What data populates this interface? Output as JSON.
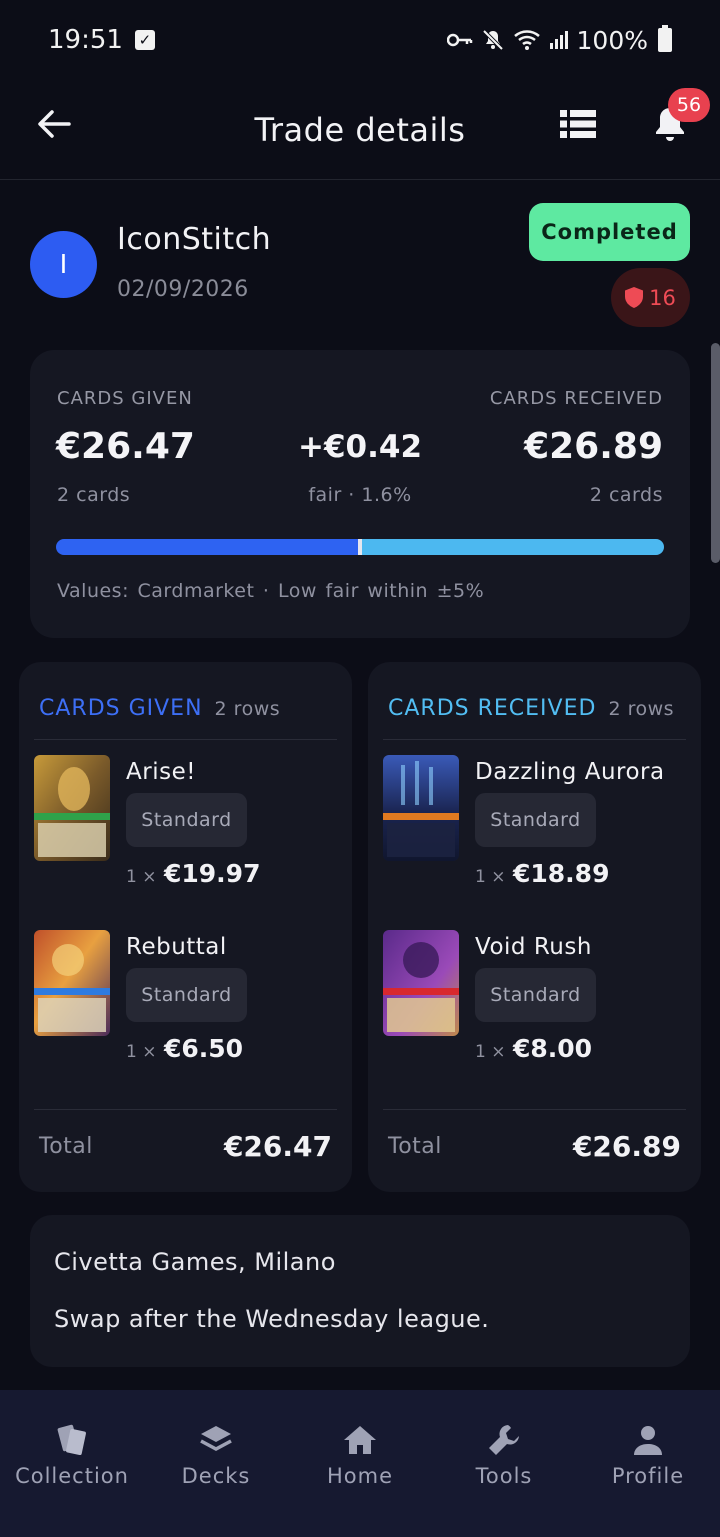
{
  "status_bar": {
    "time": "19:51",
    "battery": "100%",
    "icons": [
      "check-icon",
      "key-icon",
      "mute-icon",
      "wifi-icon",
      "signal-icon",
      "battery-icon"
    ]
  },
  "app_bar": {
    "title": "Trade details",
    "notification_count": "56"
  },
  "trade": {
    "partner_initial": "I",
    "partner_name": "IconStitch",
    "date": "02/09/2026",
    "status": "Completed",
    "reputation": "16"
  },
  "summary": {
    "given_label": "CARDS GIVEN",
    "received_label": "CARDS RECEIVED",
    "given_value": "€26.47",
    "received_value": "€26.89",
    "difference": "+€0.42",
    "given_count": "2 cards",
    "received_count": "2 cards",
    "fairness": "fair · 1.6%",
    "given_share": 0.496,
    "footer": "Values: Cardmarket · Low   fair within ±5%"
  },
  "given": {
    "title": "CARDS GIVEN",
    "rows": "2 rows",
    "items": [
      {
        "name": "Arise!",
        "variant": "Standard",
        "qty": "1 ×",
        "price": "€19.97"
      },
      {
        "name": "Rebuttal",
        "variant": "Standard",
        "qty": "1 ×",
        "price": "€6.50"
      }
    ],
    "total_label": "Total",
    "total_value": "€26.47"
  },
  "received": {
    "title": "CARDS RECEIVED",
    "rows": "2 rows",
    "items": [
      {
        "name": "Dazzling Aurora",
        "variant": "Standard",
        "qty": "1 ×",
        "price": "€18.89"
      },
      {
        "name": "Void Rush",
        "variant": "Standard",
        "qty": "1 ×",
        "price": "€8.00"
      }
    ],
    "total_label": "Total",
    "total_value": "€26.89"
  },
  "notes": {
    "location": "Civetta Games, Milano",
    "text": "Swap after the Wednesday league."
  },
  "nav": [
    {
      "label": "Collection",
      "icon": "cards-icon"
    },
    {
      "label": "Decks",
      "icon": "layers-icon"
    },
    {
      "label": "Home",
      "icon": "home-icon"
    },
    {
      "label": "Tools",
      "icon": "wrench-icon"
    },
    {
      "label": "Profile",
      "icon": "person-icon"
    }
  ],
  "colors": {
    "background": "#0c0d17",
    "surface": "#151722",
    "given_accent": "#2e63f2",
    "received_accent": "#4cb8f0",
    "completed": "#5ee9a1",
    "danger": "#e8414f"
  }
}
